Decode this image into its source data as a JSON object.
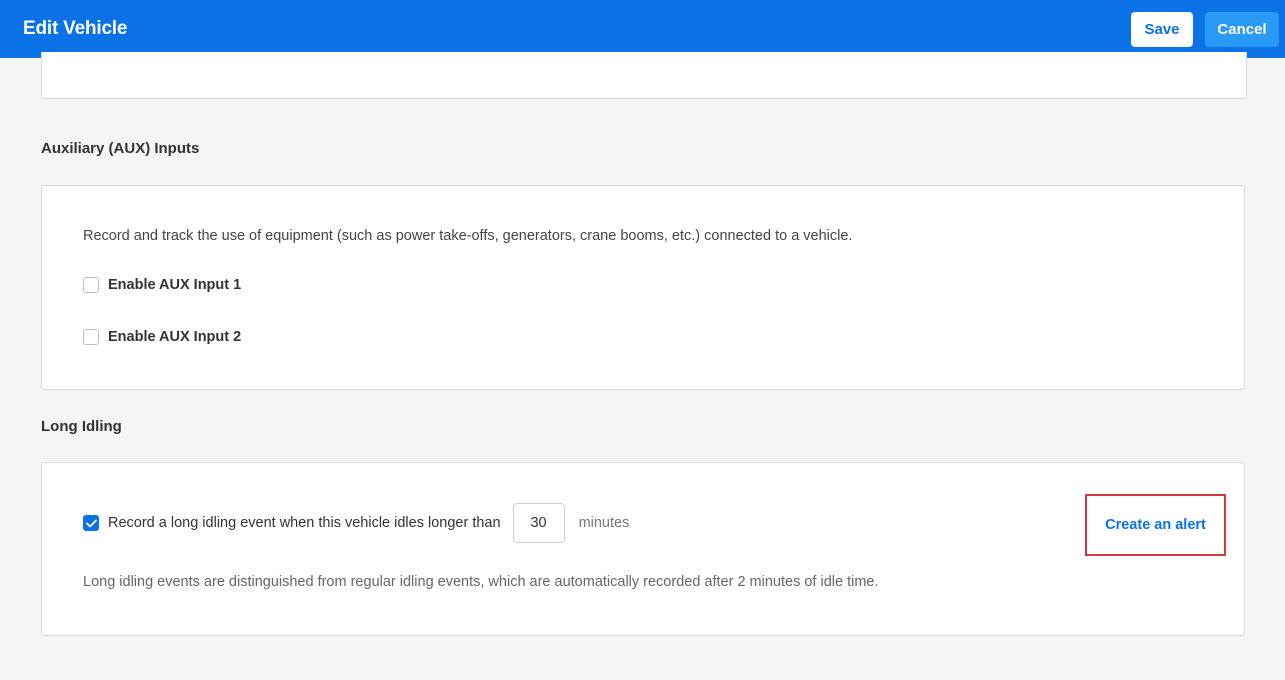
{
  "header": {
    "title": "Edit Vehicle",
    "save_label": "Save",
    "cancel_label": "Cancel"
  },
  "aux": {
    "title": "Auxiliary (AUX) Inputs",
    "description": "Record and track the use of equipment (such as power take-offs, generators, crane booms, etc.) connected to a vehicle.",
    "inputs": [
      {
        "label": "Enable AUX Input 1",
        "checked": false
      },
      {
        "label": "Enable AUX Input 2",
        "checked": false
      }
    ]
  },
  "idling": {
    "title": "Long Idling",
    "checkbox_label": "Record a long idling event when this vehicle idles longer than",
    "checked": true,
    "minutes_value": "30",
    "unit": "minutes",
    "alert_link": "Create an alert",
    "note": "Long idling events are distinguished from regular idling events, which are automatically recorded after 2 minutes of idle time."
  },
  "colors": {
    "brand": "#0a72e6",
    "highlight_border": "#d9363e"
  }
}
